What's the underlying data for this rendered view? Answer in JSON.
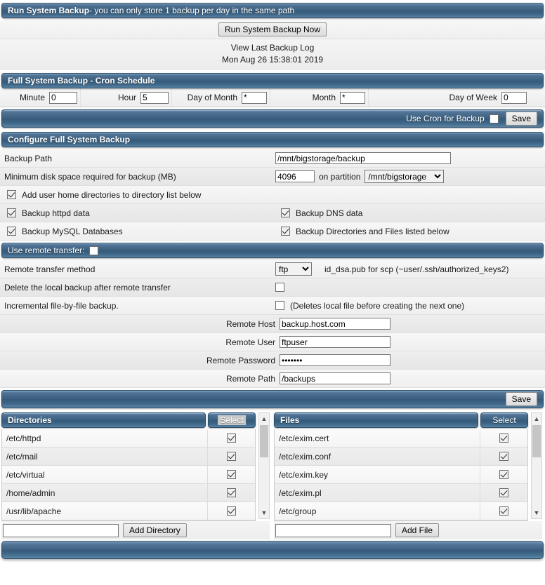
{
  "run_backup": {
    "title_bold": "Run System Backup",
    "title_rest": " - you can only store 1 backup per day in the same path",
    "run_now_button": "Run System Backup Now",
    "view_log_link": "View Last Backup Log",
    "last_backup_time": "Mon Aug 26 15:38:01 2019"
  },
  "cron": {
    "title": "Full System Backup - Cron Schedule",
    "fields": [
      {
        "label": "Minute",
        "value": "0"
      },
      {
        "label": "Hour",
        "value": "5"
      },
      {
        "label": "Day of Month",
        "value": "*"
      },
      {
        "label": "Month",
        "value": "*"
      },
      {
        "label": "Day of Week",
        "value": "0"
      }
    ],
    "use_cron_label": "Use Cron for Backup",
    "use_cron_checked": false,
    "save_button": "Save"
  },
  "configure": {
    "title": "Configure Full System Backup",
    "backup_path_label": "Backup Path",
    "backup_path_value": "/mnt/bigstorage/backup",
    "min_disk_label": "Minimum disk space required for backup (MB)",
    "min_disk_value": "4096",
    "on_partition_label": "on partition",
    "partition_value": "/mnt/bigstorage",
    "partition_options": [
      "/mnt/bigstorage"
    ],
    "add_home_label": "Add user home directories to directory list below",
    "add_home_checked": true,
    "httpd_label": "Backup httpd data",
    "httpd_checked": true,
    "dns_label": "Backup DNS data",
    "dns_checked": true,
    "mysql_label": "Backup MySQL Databases",
    "mysql_checked": true,
    "dirs_files_label": "Backup Directories and Files listed below",
    "dirs_files_checked": true
  },
  "remote": {
    "use_remote_label": "Use remote transfer:",
    "use_remote_checked": false,
    "method_label": "Remote transfer method",
    "method_value": "ftp",
    "method_options": [
      "ftp"
    ],
    "method_hint": "id_dsa.pub for scp (~user/.ssh/authorized_keys2)",
    "delete_local_label": "Delete the local backup after remote transfer",
    "delete_local_checked": false,
    "incremental_label": "Incremental file-by-file backup.",
    "incremental_checked": false,
    "incremental_hint": "(Deletes local file before creating the next one)",
    "host_label": "Remote Host",
    "host_value": "backup.host.com",
    "user_label": "Remote User",
    "user_value": "ftpuser",
    "password_label": "Remote Password",
    "password_value": "•••••••",
    "path_label": "Remote Path",
    "path_value": "/backups",
    "save_button": "Save"
  },
  "directories": {
    "title": "Directories",
    "select_header": "Select",
    "items": [
      {
        "path": "/etc/httpd",
        "checked": true
      },
      {
        "path": "/etc/mail",
        "checked": true
      },
      {
        "path": "/etc/virtual",
        "checked": true
      },
      {
        "path": "/home/admin",
        "checked": true
      },
      {
        "path": "/usr/lib/apache",
        "checked": true
      }
    ],
    "add_input_value": "",
    "add_button": "Add Directory",
    "scroll_up_icon": "▲",
    "scroll_down_icon": "▼"
  },
  "files": {
    "title": "Files",
    "select_header": "Select",
    "items": [
      {
        "path": "/etc/exim.cert",
        "checked": true
      },
      {
        "path": "/etc/exim.conf",
        "checked": true
      },
      {
        "path": "/etc/exim.key",
        "checked": true
      },
      {
        "path": "/etc/exim.pl",
        "checked": true
      },
      {
        "path": "/etc/group",
        "checked": true
      }
    ],
    "add_input_value": "",
    "add_button": "Add File",
    "scroll_up_icon": "▲",
    "scroll_down_icon": "▼"
  },
  "colors": {
    "bar_top": "#6e93b4",
    "bar_mid": "#3c607f",
    "bar_bottom": "#5a82a3",
    "bar_border": "#2c4f6b",
    "row_light": "#f7f7f7",
    "row_dark": "#e6e6e6"
  }
}
